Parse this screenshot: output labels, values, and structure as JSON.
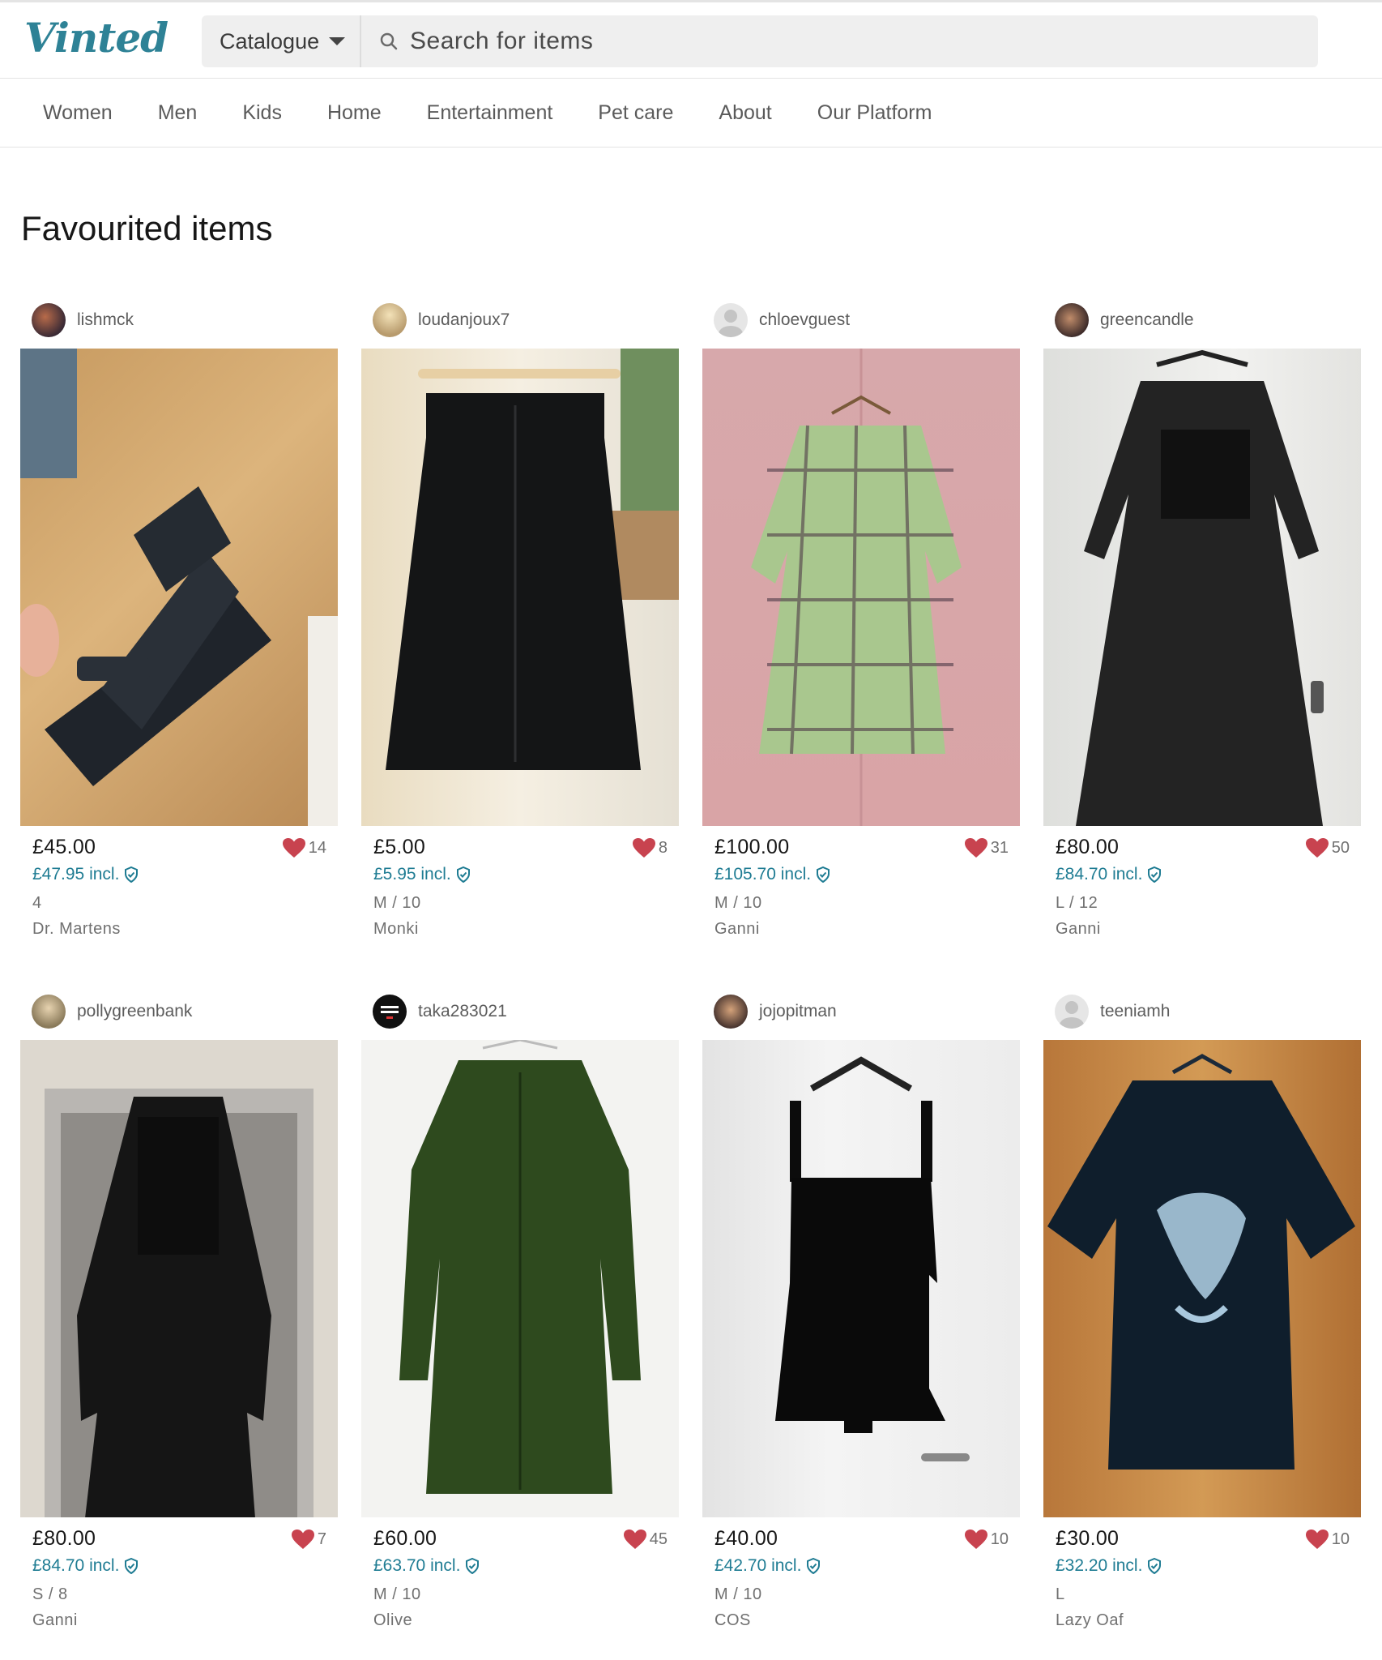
{
  "app": {
    "logo": "Vinted"
  },
  "search": {
    "catalogue_label": "Catalogue",
    "placeholder": "Search for items"
  },
  "nav": [
    "Women",
    "Men",
    "Kids",
    "Home",
    "Entertainment",
    "Pet care",
    "About",
    "Our Platform"
  ],
  "page": {
    "title": "Favourited items"
  },
  "colors": {
    "brand": "#2e8296",
    "incl_price": "#1f7c93",
    "heart": "#c8434f"
  },
  "items": [
    {
      "user": "lishmck",
      "price": "£45.00",
      "incl": "£47.95 incl.",
      "size": "4",
      "brand": "Dr. Martens",
      "favs": "14"
    },
    {
      "user": "loudanjoux7",
      "price": "£5.00",
      "incl": "£5.95 incl.",
      "size": "M / 10",
      "brand": "Monki",
      "favs": "8"
    },
    {
      "user": "chloevguest",
      "price": "£100.00",
      "incl": "£105.70 incl.",
      "size": "M / 10",
      "brand": "Ganni",
      "favs": "31"
    },
    {
      "user": "greencandle",
      "price": "£80.00",
      "incl": "£84.70 incl.",
      "size": "L / 12",
      "brand": "Ganni",
      "favs": "50"
    },
    {
      "user": "pollygreenbank",
      "price": "£80.00",
      "incl": "£84.70 incl.",
      "size": "S / 8",
      "brand": "Ganni",
      "favs": "7"
    },
    {
      "user": "taka283021",
      "price": "£60.00",
      "incl": "£63.70 incl.",
      "size": "M / 10",
      "brand": "Olive",
      "favs": "45"
    },
    {
      "user": "jojopitman",
      "price": "£40.00",
      "incl": "£42.70 incl.",
      "size": "M / 10",
      "brand": "COS",
      "favs": "10"
    },
    {
      "user": "teeniamh",
      "price": "£30.00",
      "incl": "£32.20 incl.",
      "size": "L",
      "brand": "Lazy Oaf",
      "favs": "10"
    }
  ]
}
